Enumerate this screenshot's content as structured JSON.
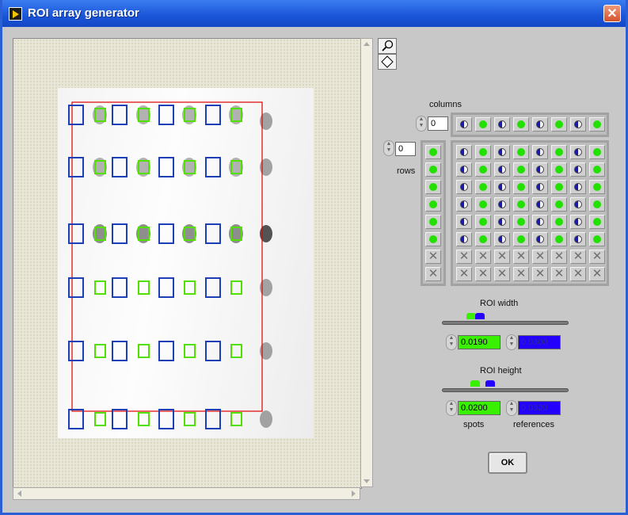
{
  "window": {
    "title": "ROI array generator",
    "close_symbol": "✕"
  },
  "tools": {
    "zoom_icon": "magnifier-icon",
    "pointer_icon": "pointer-diamond-icon"
  },
  "grid": {
    "columns_label": "columns",
    "columns_value": "0",
    "rows_label": "rows",
    "rows_value": "0",
    "column_pattern": [
      "blue-white",
      "green",
      "blue-white",
      "green",
      "blue-white",
      "green",
      "blue-white",
      "green"
    ],
    "row_pattern": [
      "green",
      "green",
      "green",
      "green",
      "green",
      "green",
      "x",
      "x"
    ]
  },
  "roi_width": {
    "label": "ROI width",
    "spots_value": "0.0190",
    "references_value": "0.0300",
    "spots_fraction": 0.23,
    "references_fraction": 0.3
  },
  "roi_height": {
    "label": "ROI height",
    "spots_value": "0.0200",
    "references_value": "0.0320",
    "spots_fraction": 0.26,
    "references_fraction": 0.38,
    "spots_label": "spots",
    "references_label": "references"
  },
  "ok_button": "OK",
  "colors": {
    "title_bar": "#1a55d8",
    "spot_green": "#39f000",
    "reference_blue": "#2400ff",
    "boundary_red": "#e00000"
  }
}
